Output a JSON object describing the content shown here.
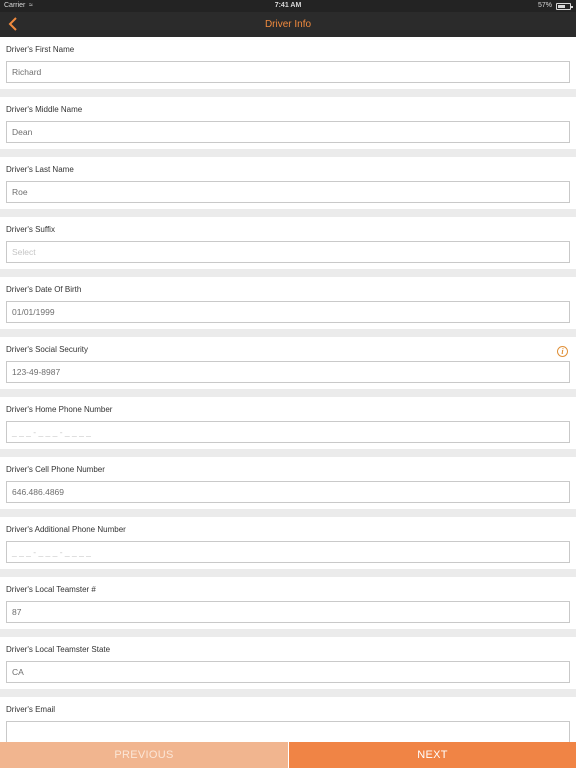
{
  "status_bar": {
    "carrier": "Carrier",
    "wifi_icon": "wifi-icon",
    "time": "7:41 AM",
    "battery": "57%",
    "battery_level": 0.57
  },
  "nav": {
    "back_icon": "chevron-left-icon",
    "title": "Driver Info",
    "accent_color": "#f08a3e"
  },
  "fields": [
    {
      "label": "Driver's First Name",
      "value": "Richard",
      "placeholder": ""
    },
    {
      "label": "Driver's Middle Name",
      "value": "Dean",
      "placeholder": ""
    },
    {
      "label": "Driver's Last Name",
      "value": "Roe",
      "placeholder": ""
    },
    {
      "label": "Driver's Suffix",
      "value": "",
      "placeholder": "Select"
    },
    {
      "label": "Driver's Date Of Birth",
      "value": "01/01/1999",
      "placeholder": ""
    },
    {
      "label": "Driver's Social Security",
      "value": "123-49-8987",
      "placeholder": "",
      "info_icon": "info-icon",
      "info_glyph": "i"
    },
    {
      "label": "Driver's Home Phone Number",
      "value": "",
      "placeholder": "_ _ _ - _ _ _ - _ _ _ _"
    },
    {
      "label": "Driver's Cell Phone Number",
      "value": "646.486.4869",
      "placeholder": ""
    },
    {
      "label": "Driver's Additional Phone Number",
      "value": "",
      "placeholder": "_ _ _ - _ _ _ - _ _ _ _"
    },
    {
      "label": "Driver's Local Teamster #",
      "value": "87",
      "placeholder": ""
    },
    {
      "label": "Driver's Local Teamster State",
      "value": "CA",
      "placeholder": ""
    },
    {
      "label": "Driver's Email",
      "value": "",
      "placeholder": ""
    }
  ],
  "buttons": {
    "previous": "PREVIOUS",
    "next": "NEXT",
    "previous_color": "#f1b58f",
    "next_color": "#f08445"
  }
}
